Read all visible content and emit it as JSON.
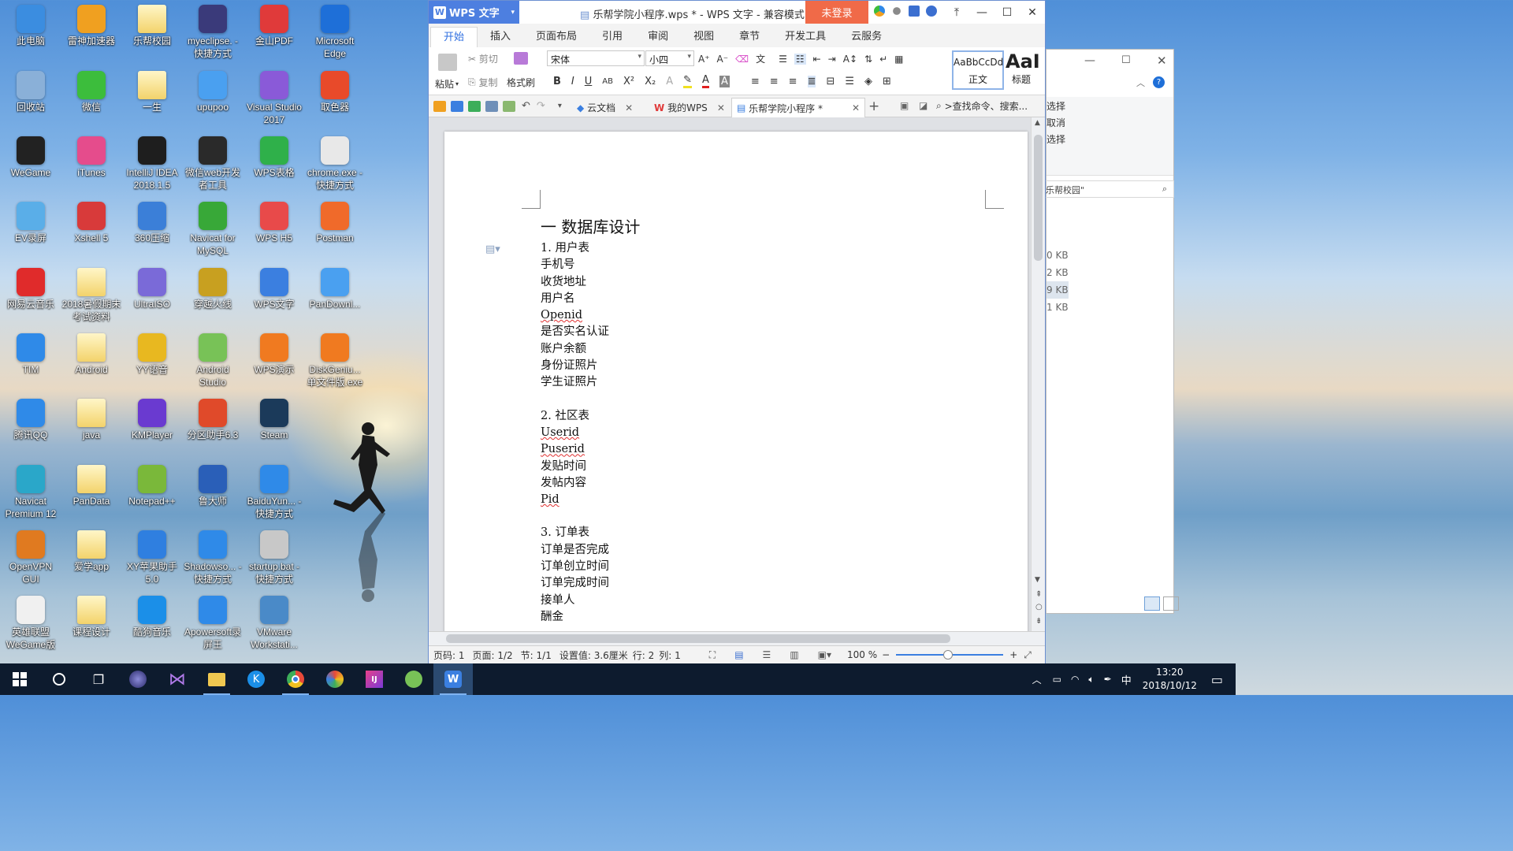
{
  "desktop": {
    "icons": [
      {
        "label": "此电脑",
        "icon": "computer-icon",
        "color": "#3b8de0"
      },
      {
        "label": "回收站",
        "icon": "recycle-bin-icon",
        "color": "#8ab0d8"
      },
      {
        "label": "WeGame",
        "icon": "wegame-icon",
        "color": "#222222"
      },
      {
        "label": "EV录屏",
        "icon": "ev-recorder-icon",
        "color": "#5aaee8"
      },
      {
        "label": "网易云音乐",
        "icon": "netease-music-icon",
        "color": "#e02b2b"
      },
      {
        "label": "TIM",
        "icon": "tim-icon",
        "color": "#2f8ae8"
      },
      {
        "label": "腾讯QQ",
        "icon": "qq-icon",
        "color": "#2f8ae8"
      },
      {
        "label": "Navicat Premium 12",
        "icon": "navicat-icon",
        "color": "#2aa7c9"
      },
      {
        "label": "OpenVPN GUI",
        "icon": "openvpn-icon",
        "color": "#e07a20"
      },
      {
        "label": "英雄联盟WeGame版",
        "icon": "file-icon",
        "color": "#f0f0f0"
      },
      {
        "label": "雷神加速器",
        "icon": "thunder-accelerator-icon",
        "color": "#f0a020"
      },
      {
        "label": "微信",
        "icon": "wechat-icon",
        "color": "#3cbd3c"
      },
      {
        "label": "iTunes",
        "icon": "itunes-icon",
        "color": "#e54c8c"
      },
      {
        "label": "Xshell 5",
        "icon": "xshell-icon",
        "color": "#d83a3a"
      },
      {
        "label": "2018暑假期末考试资料",
        "icon": "folder-icon",
        "color": "folder"
      },
      {
        "label": "Android",
        "icon": "folder-icon",
        "color": "folder"
      },
      {
        "label": "java",
        "icon": "folder-icon",
        "color": "folder"
      },
      {
        "label": "PanData",
        "icon": "folder-icon",
        "color": "folder"
      },
      {
        "label": "爱学app",
        "icon": "folder-icon",
        "color": "folder"
      },
      {
        "label": "课程设计",
        "icon": "folder-icon",
        "color": "folder"
      },
      {
        "label": "乐帮校园",
        "icon": "folder-icon",
        "color": "folder"
      },
      {
        "label": "一生",
        "icon": "folder-icon",
        "color": "folder"
      },
      {
        "label": "IntelliJ IDEA 2018.1.5",
        "icon": "intellij-icon",
        "color": "#1e1e1e"
      },
      {
        "label": "360压缩",
        "icon": "archive-icon",
        "color": "#3b7fd8"
      },
      {
        "label": "UltraISO",
        "icon": "ultraiso-icon",
        "color": "#7a6ad8"
      },
      {
        "label": "YY语音",
        "icon": "yy-icon",
        "color": "#e8b820"
      },
      {
        "label": "KMPlayer",
        "icon": "kmplayer-icon",
        "color": "#6a3ad0"
      },
      {
        "label": "Notepad++",
        "icon": "notepad-icon",
        "color": "#7ab83a"
      },
      {
        "label": "XY苹果助手5.0",
        "icon": "xy-assistant-icon",
        "color": "#2f7fe0"
      },
      {
        "label": "酷狗音乐",
        "icon": "kugou-icon",
        "color": "#1b8fe8"
      },
      {
        "label": "myeclipse. - 快捷方式",
        "icon": "eclipse-icon",
        "color": "#3a3a7a"
      },
      {
        "label": "upupoo",
        "icon": "upupoo-icon",
        "color": "#4aa0f0"
      },
      {
        "label": "微信web开发者工具",
        "icon": "terminal-icon",
        "color": "#2a2a2a"
      },
      {
        "label": "Navicat for MySQL",
        "icon": "navicat-mysql-icon",
        "color": "#38a838"
      },
      {
        "label": "穿越火线",
        "icon": "crossfire-icon",
        "color": "#c8a020"
      },
      {
        "label": "Android Studio",
        "icon": "android-studio-icon",
        "color": "#78c257"
      },
      {
        "label": "分区助手6.3",
        "icon": "partition-icon",
        "color": "#e04a2a"
      },
      {
        "label": "鲁大师",
        "icon": "ludashi-icon",
        "color": "#2a5fb8"
      },
      {
        "label": "Shadowso... - 快捷方式",
        "icon": "shadowsocks-icon",
        "color": "#2f8ae8"
      },
      {
        "label": "Apowersoft录屏王",
        "icon": "apowersoft-icon",
        "color": "#2f8ae8"
      },
      {
        "label": "金山PDF",
        "icon": "pdf-icon",
        "color": "#e03a3a"
      },
      {
        "label": "Visual Studio 2017",
        "icon": "visual-studio-icon",
        "color": "#8a5ad8"
      },
      {
        "label": "WPS表格",
        "icon": "wps-sheet-icon",
        "color": "#2fb04a"
      },
      {
        "label": "WPS H5",
        "icon": "wps-h5-icon",
        "color": "#e84a4a"
      },
      {
        "label": "WPS文字",
        "icon": "wps-writer-icon",
        "color": "#3b7fe0"
      },
      {
        "label": "WPS演示",
        "icon": "wps-presentation-icon",
        "color": "#f07a20"
      },
      {
        "label": "Steam",
        "icon": "steam-icon",
        "color": "#1b3a5a"
      },
      {
        "label": "BaiduYun... - 快捷方式",
        "icon": "baiduyun-icon",
        "color": "#2f8ae8"
      },
      {
        "label": "startup.bat - 快捷方式",
        "icon": "bat-file-icon",
        "color": "#c8c8c8"
      },
      {
        "label": "VMware Workstati...",
        "icon": "vmware-icon",
        "color": "#4a8ac8"
      },
      {
        "label": "Microsoft Edge",
        "icon": "edge-icon",
        "color": "#1e6fd8"
      },
      {
        "label": "取色器",
        "icon": "color-picker-icon",
        "color": "#e84a2a"
      },
      {
        "label": "chrome.exe - 快捷方式",
        "icon": "chrome-icon",
        "color": "#e8e8e8"
      },
      {
        "label": "Postman",
        "icon": "postman-icon",
        "color": "#f06a2a"
      },
      {
        "label": "PanDownl...",
        "icon": "pandownload-icon",
        "color": "#4aa0f0"
      },
      {
        "label": "DiskGeniu... 单文件版.exe",
        "icon": "diskgenius-icon",
        "color": "#f07a20"
      }
    ]
  },
  "wps": {
    "app_button": "WPS 文字",
    "title": "乐帮学院小程序.wps * - WPS 文字 - 兼容模式",
    "login": "未登录",
    "ribbon_tabs": [
      "开始",
      "插入",
      "页面布局",
      "引用",
      "审阅",
      "视图",
      "章节",
      "开发工具",
      "云服务"
    ],
    "ribbon": {
      "paste": "粘贴",
      "cut": "剪切",
      "copy": "复制",
      "format_painter": "格式刷",
      "font": "宋体",
      "size": "小四",
      "style_normal_preview": "AaBbCcDd",
      "style_normal": "正文",
      "style_heading_preview": "AaI",
      "style_heading": "标题"
    },
    "doc_tabs": [
      {
        "label": "云文档",
        "icon": "cloud-doc-icon"
      },
      {
        "label": "我的WPS",
        "icon": "wps-logo-icon"
      },
      {
        "label": "乐帮学院小程序 *",
        "icon": "document-icon"
      }
    ],
    "search_placeholder": ">查找命令、搜索...",
    "document": {
      "heading": "一  数据库设计",
      "lines": [
        {
          "text": "1.  用户表",
          "squiggle": false
        },
        {
          "text": "手机号",
          "squiggle": false
        },
        {
          "text": "收货地址",
          "squiggle": false
        },
        {
          "text": "用户名",
          "squiggle": false
        },
        {
          "text": "Openid",
          "squiggle": true
        },
        {
          "text": "是否实名认证",
          "squiggle": false
        },
        {
          "text": "账户余额",
          "squiggle": false
        },
        {
          "text": "身份证照片",
          "squiggle": false
        },
        {
          "text": "学生证照片",
          "squiggle": false
        },
        {
          "text": "",
          "squiggle": false
        },
        {
          "text": "2.  社区表",
          "squiggle": false
        },
        {
          "text": "Userid",
          "squiggle": true
        },
        {
          "text": "Puserid",
          "squiggle": true
        },
        {
          "text": "发贴时间",
          "squiggle": false
        },
        {
          "text": "发帖内容",
          "squiggle": false
        },
        {
          "text": "Pid",
          "squiggle": true
        },
        {
          "text": "",
          "squiggle": false
        },
        {
          "text": "3.  订单表",
          "squiggle": false
        },
        {
          "text": "订单是否完成",
          "squiggle": false
        },
        {
          "text": "订单创立时间",
          "squiggle": false
        },
        {
          "text": "订单完成时间",
          "squiggle": false
        },
        {
          "text": "接单人",
          "squiggle": false
        },
        {
          "text": "酬金",
          "squiggle": false
        }
      ]
    },
    "status": {
      "page_no": "页码: 1",
      "page": "页面: 1/2",
      "section": "节: 1/1",
      "setting": "设置值: 3.6厘米",
      "row": "行: 2",
      "col": "列: 1",
      "zoom": "100 %"
    }
  },
  "explorer": {
    "menu": [
      "选择",
      "取消",
      "选择"
    ],
    "search_placeholder": "乐帮校园\"",
    "sizes": [
      "0 KB",
      "2 KB",
      "9 KB",
      "1 KB"
    ]
  },
  "taskbar": {
    "items": [
      "start-icon",
      "cortana-icon",
      "task-view-icon",
      "eclipse-icon",
      "visual-studio-icon",
      "file-explorer-icon",
      "kugou-icon",
      "chrome-icon",
      "wegame-icon",
      "intellij-icon",
      "android-studio-icon",
      "wps-writer-icon"
    ],
    "ime": "中",
    "time": "13:20",
    "date": "2018/10/12"
  }
}
